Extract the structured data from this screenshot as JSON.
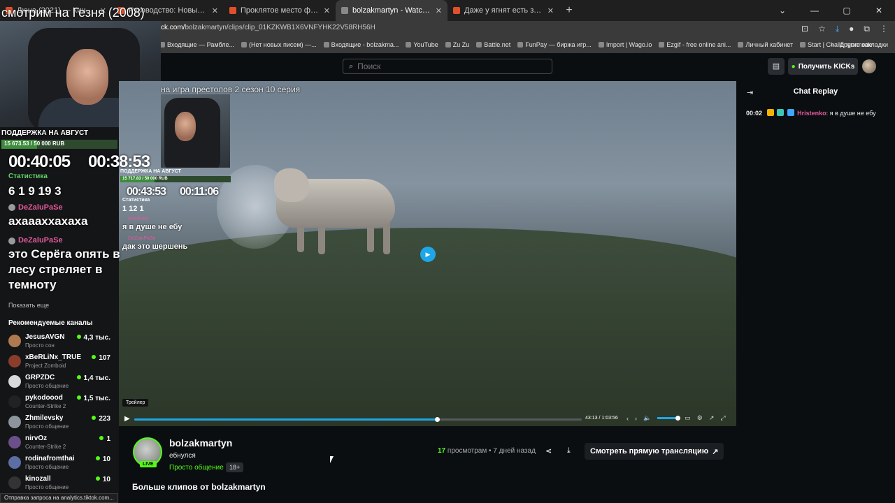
{
  "browser": {
    "tabs": [
      {
        "label": "Дюна (2021) — Кинопоиск"
      },
      {
        "label": "Руководство: Новый ритуал фи"
      },
      {
        "label": "Проклятое место фильм, 2013"
      },
      {
        "label": "bolzakmartyn - Watch clips",
        "active": true
      },
      {
        "label": "Даже у ягнят есть зубы фильм"
      }
    ],
    "url_prefix": "ck.com/",
    "url_path": "bolzakmartyn/clips/clip_01KZKWB1X6VNFYHK22V58RH56H",
    "bookmarks": [
      "Входящие — Рамбле...",
      "(Нет новых писем) —...",
      "Входящие - bolzakma...",
      "YouTube",
      "Zu Zu",
      "Battle.net",
      "FunPay — биржа игр...",
      "Import | Wago.io",
      "Ezgif - free online ani...",
      "Личный кабинет",
      "Start | Challengermode"
    ],
    "other_bookmarks": "Другие закладки",
    "status": "Отправка запроса на analytics.tiktok.com..."
  },
  "header": {
    "search_placeholder": "Поиск",
    "kicks_label": "Получить KICKs"
  },
  "overlay": {
    "title": "смотрим на Гезня (2008)",
    "support_label": "ПОДДЕРЖКА НА АВГУСТ",
    "support_amount": "15 673.53 / 50 000 RUB",
    "support_fraction": 0.31,
    "timer_left": "00:40:05",
    "timer_right": "00:38:53",
    "stats_label": "Статистика",
    "counts": "6 1 9 19 3",
    "messages": [
      {
        "user": "DeZaluPaSe",
        "text": "ахаааххахаха"
      },
      {
        "user": "DeZaluPaSe",
        "text": "это Серёга опять в лесу стреляет в темноту"
      }
    ]
  },
  "overlay_small": {
    "support_label": "ПОДДЕРЖКА НА АВГУСТ",
    "support_amount": "15 717.83 / 50 000 RUB",
    "timer_left": "00:43:53",
    "timer_right": "00:11:06",
    "stats_label": "Статистика",
    "counts": "1 12 1",
    "messages": [
      {
        "user": "Hristenko",
        "text": "я в душе не ебу"
      },
      {
        "user": "DeZaluPaSe",
        "text": "дак это шершень"
      }
    ]
  },
  "video": {
    "title": "на игра престолов 2 сезон 10 серия",
    "trailer_tip": "Трейлер",
    "time": "43:13  /  1:03:56",
    "progress": 0.676,
    "volume": 0.9
  },
  "sidebar": {
    "show_more": "Показать еще",
    "recommended_title": "Рекомендуемые каналы",
    "channels": [
      {
        "name": "JesusAVGN",
        "category": "Просто сон",
        "viewers": "4,3 тыс.",
        "color": "#b07a50"
      },
      {
        "name": "xBeRLiNx_TRUE",
        "category": "Project Zomboid",
        "viewers": "107",
        "color": "#8a3d2b"
      },
      {
        "name": "GRPZDC",
        "category": "Просто общение",
        "viewers": "1,4 тыс.",
        "color": "#d9d9d9"
      },
      {
        "name": "pykodoood",
        "category": "Counter-Strike 2",
        "viewers": "1,5 тыс.",
        "color": "#222222"
      },
      {
        "name": "Zhmilevsky",
        "category": "Просто общение",
        "viewers": "223",
        "color": "#8d949b"
      },
      {
        "name": "nirvOz",
        "category": "Counter-Strike 2",
        "viewers": "1",
        "color": "#6b4f8a"
      },
      {
        "name": "rodinafromthai",
        "category": "Просто общение",
        "viewers": "10",
        "color": "#5b6fa5"
      },
      {
        "name": "kinozall",
        "category": "Просто общение",
        "viewers": "10",
        "color": "#333333"
      }
    ]
  },
  "clip": {
    "channel_name": "bolzakmartyn",
    "live_label": "LIVE",
    "title": "ебнулся",
    "category": "Просто общение",
    "age": "18+",
    "views_count": "17",
    "views_label": "просмотрам",
    "separator": "•",
    "posted": "7 дней назад",
    "watch_live": "Смотреть прямую трансляцию",
    "more_clips": "Больше клипов от bolzakmartyn"
  },
  "chat": {
    "title": "Chat Replay",
    "lines": [
      {
        "time": "00:02",
        "user": "Hristenko",
        "text": "я в душе не ебу"
      }
    ]
  }
}
